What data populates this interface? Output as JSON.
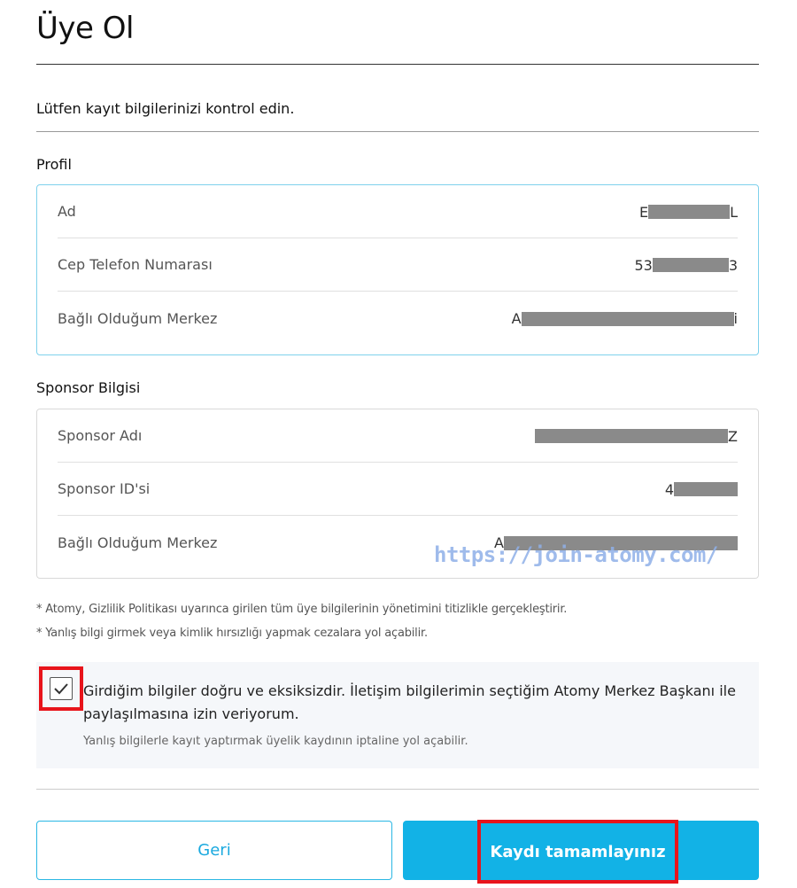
{
  "page": {
    "title": "Üye Ol",
    "subtitle": "Lütfen kayıt bilgilerinizi kontrol edin."
  },
  "profile": {
    "heading": "Profil",
    "rows": [
      {
        "label": "Ad",
        "value_start": "E",
        "value_end": "L"
      },
      {
        "label": "Cep Telefon Numarası",
        "value_start": "53",
        "value_end": "3"
      },
      {
        "label": "Bağlı Olduğum Merkez",
        "value_start": "A",
        "value_end": "i"
      }
    ]
  },
  "sponsor": {
    "heading": "Sponsor Bilgisi",
    "rows": [
      {
        "label": "Sponsor Adı",
        "value_start": "",
        "value_end": "Z"
      },
      {
        "label": "Sponsor ID'si",
        "value_start": "4",
        "value_end": ""
      },
      {
        "label": "Bağlı Olduğum Merkez",
        "value_start": "A",
        "value_end": ""
      }
    ]
  },
  "watermark": "https://join-atomy.com/",
  "notes": [
    "* Atomy, Gizlilik Politikası uyarınca girilen tüm üye bilgilerinin yönetimini titizlikle gerçekleştirir.",
    "* Yanlış bilgi girmek veya kimlik hırsızlığı yapmak cezalara yol açabilir."
  ],
  "agreement": {
    "checked": true,
    "text": "Girdiğim bilgiler doğru ve eksiksizdir. İletişim bilgilerimin seçtiğim Atomy Merkez Başkanı ile paylaşılmasına izin veriyorum.",
    "subtext": "Yanlış bilgilerle kayıt yaptırmak üyelik kaydının iptaline yol açabilir."
  },
  "buttons": {
    "back": "Geri",
    "complete": "Kaydı tamamlayınız"
  },
  "colors": {
    "accent": "#12b2e6",
    "highlight": "#e8141b",
    "redaction": "#8a8a8a"
  }
}
